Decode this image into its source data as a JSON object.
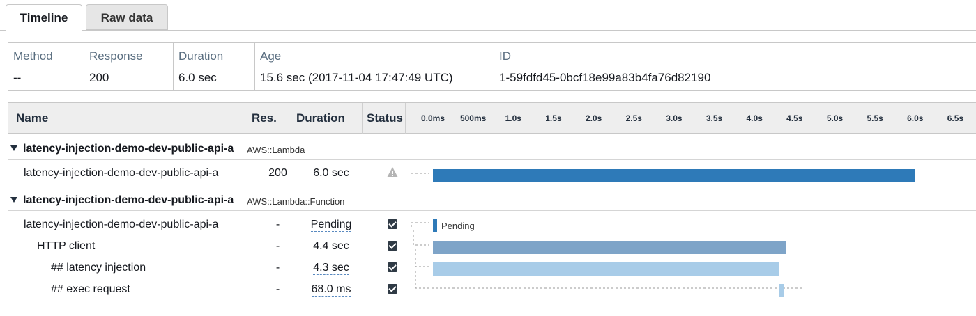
{
  "tabs": {
    "timeline": "Timeline",
    "raw": "Raw data"
  },
  "summary": {
    "method": {
      "label": "Method",
      "value": "--"
    },
    "response": {
      "label": "Response",
      "value": "200"
    },
    "duration": {
      "label": "Duration",
      "value": "6.0 sec"
    },
    "age": {
      "label": "Age",
      "value": "15.6 sec (2017-11-04 17:47:49 UTC)"
    },
    "id": {
      "label": "ID",
      "value": "1-59fdfd45-0bcf18e99a83b4fa76d82190"
    }
  },
  "table": {
    "headers": {
      "name": "Name",
      "res": "Res.",
      "duration": "Duration",
      "status": "Status"
    },
    "ticks": [
      "0.0ms",
      "500ms",
      "1.0s",
      "1.5s",
      "2.0s",
      "2.5s",
      "3.0s",
      "3.5s",
      "4.0s",
      "4.5s",
      "5.0s",
      "5.5s",
      "6.0s",
      "6.5s"
    ]
  },
  "groups": [
    {
      "name": "latency-injection-demo-dev-public-api-a",
      "type": "AWS::Lambda"
    },
    {
      "name": "latency-injection-demo-dev-public-api-a",
      "type": "AWS::Lambda::Function"
    }
  ],
  "rows": [
    {
      "name": "latency-injection-demo-dev-public-api-a",
      "res": "200",
      "duration": "6.0 sec",
      "status": "warning-icon",
      "start_s": 0.0,
      "duration_s": 6.0
    },
    {
      "name": "latency-injection-demo-dev-public-api-a",
      "res": "-",
      "duration": "Pending",
      "status": "check-icon",
      "start_s": 0.0,
      "duration_s": 0.0,
      "bar_label": "Pending"
    },
    {
      "name": "HTTP client",
      "res": "-",
      "duration": "4.4 sec",
      "status": "check-icon",
      "start_s": 0.0,
      "duration_s": 4.4
    },
    {
      "name": "## latency injection",
      "res": "-",
      "duration": "4.3 sec",
      "status": "check-icon",
      "start_s": 0.0,
      "duration_s": 4.3
    },
    {
      "name": "## exec request",
      "res": "-",
      "duration": "68.0 ms",
      "status": "check-icon",
      "start_s": 4.3,
      "duration_s": 0.068
    }
  ],
  "colors": {
    "primary_bar": "#2e7ab8",
    "http_bar": "#7ea4c8",
    "light_bar": "#a8cce8"
  }
}
